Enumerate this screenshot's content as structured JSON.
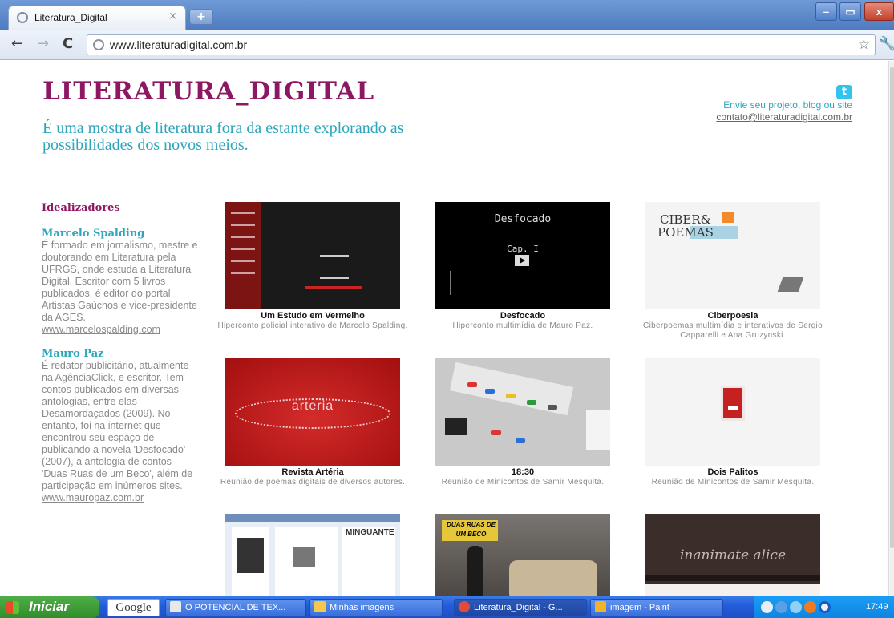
{
  "browser": {
    "tab_title": "Literatura_Digital",
    "tab_close_glyph": "×",
    "new_tab_glyph": "+",
    "url": "www.literaturadigital.com.br",
    "window_buttons": {
      "minimize": "–",
      "maximize": "▭",
      "close": "x"
    }
  },
  "site": {
    "title": "LITERATURA_DIGITAL",
    "tagline": "É uma mostra de literatura fora da estante explorando as possibilidades dos novos meios.",
    "contact_line1": "Envie seu projeto, blog ou site",
    "contact_line2": "contato@literaturadigital.com.br",
    "accent_color": "#8e1763",
    "secondary_color": "#2da6bb"
  },
  "sidebar": {
    "heading": "Idealizadores",
    "authors": [
      {
        "name": "Marcelo Spalding",
        "bio": "É formado em jornalismo, mestre e doutorando em Literatura pela UFRGS, onde estuda a Literatura Digital. Escritor com 5 livros publicados, é editor do portal Artistas Gaúchos e vice-presidente da AGES.",
        "link": "www.marcelospalding.com"
      },
      {
        "name": "Mauro Paz",
        "bio": "É redator publicitário, atualmente na AgênciaClick, e escritor. Tem contos publicados em diversas antologias, entre elas Desamordaçados (2009). No entanto, foi na internet que encontrou seu espaço de publicando a novela 'Desfocado' (2007), a antologia de contos 'Duas Ruas de um Beco', além de participação em inúmeros sites.",
        "link": "www.mauropaz.com.br"
      }
    ]
  },
  "projects": [
    {
      "title": "Um Estudo em Vermelho",
      "description": "Hiperconto policial interativo de Marcelo Spalding."
    },
    {
      "title": "Desfocado",
      "description": "Hiperconto multimídia de Mauro Paz."
    },
    {
      "title": "Ciberpoesia",
      "description": "Ciberpoemas multimídia e interativos de Sergio Capparelli e Ana Gruzynski."
    },
    {
      "title": "Revista Artéria",
      "description": "Reunião de poemas digitais de diversos autores."
    },
    {
      "title": "18:30",
      "description": "Reunião de Minicontos de Samir Mesquita."
    },
    {
      "title": "Dois Palitos",
      "description": "Reunião de Minicontos de Samir Mesquita."
    }
  ],
  "thumb_text": {
    "desfocado_title": "Desfocado",
    "desfocado_cap": "Cap. I",
    "ciber_logo": "CIBER& POEMAS",
    "arteria_word": "arteria",
    "minguante": "MINGUANTE",
    "duas_ruas": "DUAS RUAS DE UM BECO",
    "alice": "inanimate alice"
  },
  "taskbar": {
    "start_label": "Iniciar",
    "google_label": "Google",
    "items": [
      {
        "label": "O POTENCIAL DE TEX...",
        "icon_color": "#e8e8e8"
      },
      {
        "label": "Minhas imagens",
        "icon_color": "#f3c94a"
      },
      {
        "label": "Literatura_Digital - G...",
        "icon_color": "#e04b3a"
      },
      {
        "label": "imagem - Paint",
        "icon_color": "#f2b32b"
      }
    ],
    "clock": "17:49"
  }
}
